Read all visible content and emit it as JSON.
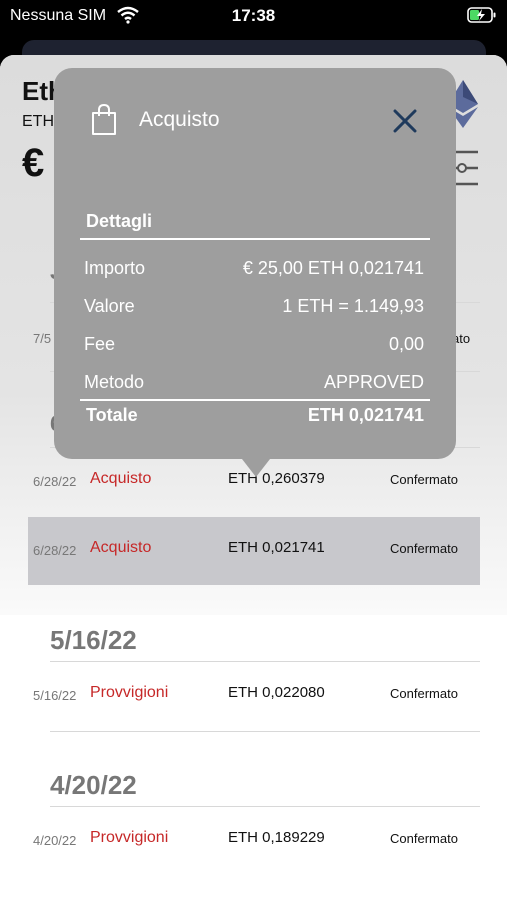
{
  "status_bar": {
    "carrier": "Nessuna SIM",
    "time": "17:38"
  },
  "header": {
    "title": "Eth",
    "subtitle": "ETH",
    "balance": "€"
  },
  "popover": {
    "title": "Acquisto",
    "section": "Dettagli",
    "rows": [
      {
        "label": "Importo",
        "value": "€ 25,00 ETH 0,021741"
      },
      {
        "label": "Valore",
        "value": "1 ETH = 1.149,93"
      },
      {
        "label": "Fee",
        "value": "0,00"
      },
      {
        "label": "Metodo",
        "value": "APPROVED"
      }
    ],
    "total": {
      "label": "Totale",
      "value": "ETH 0,021741"
    }
  },
  "partial_rows": {
    "date_1": "7/5",
    "group_1": "J",
    "status_1": "ato",
    "group_2": "6"
  },
  "transactions": [
    {
      "date": "6/28/22",
      "type": "Acquisto",
      "amount": "ETH 0,260379",
      "status": "Confermato"
    },
    {
      "date": "6/28/22",
      "type": "Acquisto",
      "amount": "ETH 0,021741",
      "status": "Confermato"
    },
    {
      "date": "5/16/22",
      "type": "Provvigioni",
      "amount": "ETH 0,022080",
      "status": "Confermato"
    },
    {
      "date": "4/20/22",
      "type": "Provvigioni",
      "amount": "ETH 0,189229",
      "status": "Confermato"
    }
  ],
  "groups": [
    {
      "label": "5/16/22"
    },
    {
      "label": "4/20/22"
    }
  ],
  "colors": {
    "type_red": "#c62828",
    "popover_bg": "#9e9e9e",
    "close_blue": "#1f3a5c"
  }
}
